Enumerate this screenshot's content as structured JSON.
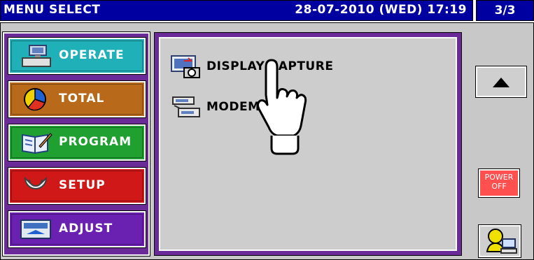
{
  "header": {
    "title": "MENU SELECT",
    "datetime": "28-07-2010 (WED) 17:19",
    "page": "3/3"
  },
  "sidebar": {
    "items": [
      {
        "label": "OPERATE",
        "color": "#1fb0b8",
        "icon": "operator-terminal-icon"
      },
      {
        "label": "TOTAL",
        "color": "#b86a1a",
        "icon": "pie-chart-icon"
      },
      {
        "label": "PROGRAM",
        "color": "#1fa030",
        "icon": "program-book-icon"
      },
      {
        "label": "SETUP",
        "color": "#d01818",
        "icon": "wrench-icon"
      },
      {
        "label": "ADJUST",
        "color": "#6a20b0",
        "icon": "adjust-scale-icon"
      }
    ]
  },
  "main": {
    "items": [
      {
        "label": "DISPLAY CAPTURE",
        "icon": "display-capture-icon"
      },
      {
        "label": "MODEM",
        "icon": "modem-icon"
      }
    ]
  },
  "right": {
    "up_arrow": "up-arrow-icon",
    "power_label_1": "POWER",
    "power_label_2": "OFF",
    "user_icon": "operator-user-icon"
  }
}
